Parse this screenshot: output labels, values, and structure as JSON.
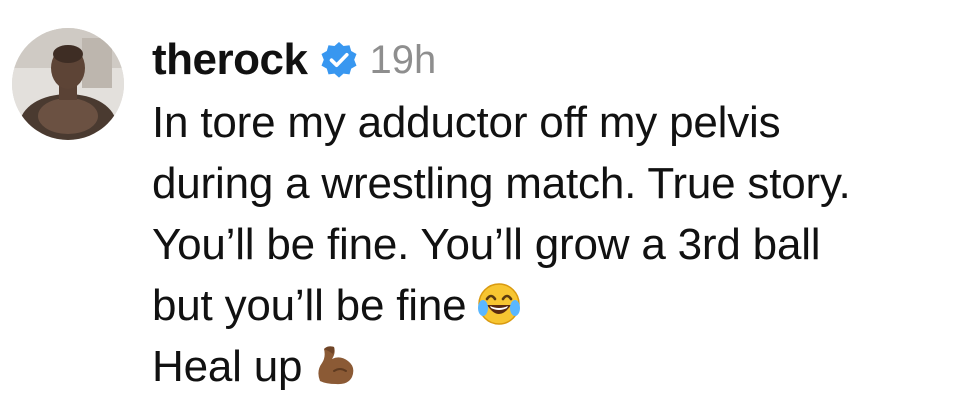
{
  "comment": {
    "username": "therock",
    "verified_icon": "verified-badge-icon",
    "timestamp": "19h",
    "lines": [
      "In tore my adductor off my pelvis",
      "during a wrestling match. True story.",
      "You’ll be fine. You’ll grow a 3rd ball",
      "but you’ll be fine",
      "Heal up"
    ],
    "emojis": {
      "line4": "laughing-crying-face-icon",
      "line5": "flexed-biceps-icon"
    }
  },
  "colors": {
    "text": "#111111",
    "timestamp": "#8e8e8e",
    "verified": "#3897f0"
  }
}
